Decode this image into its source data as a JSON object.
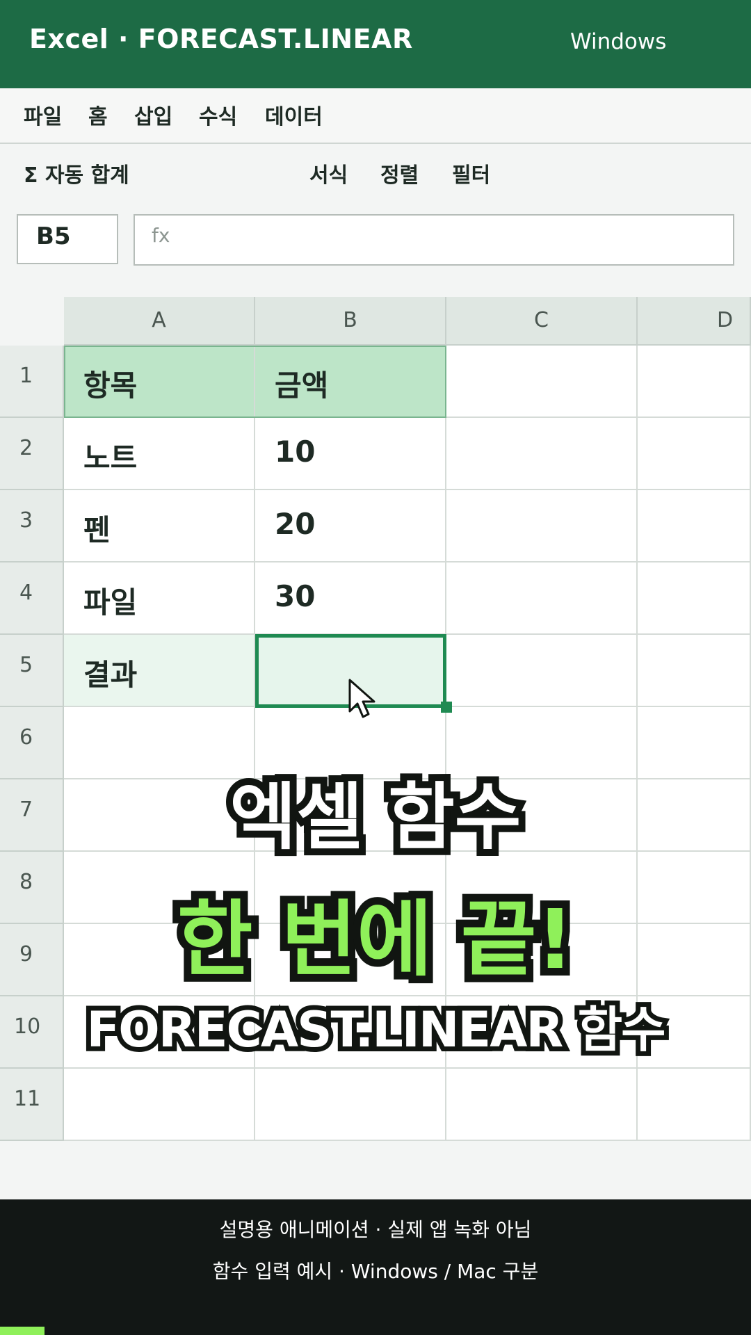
{
  "app": {
    "title": "Excel · FORECAST.LINEAR",
    "platform": "Windows"
  },
  "menu": [
    "파일",
    "홈",
    "삽입",
    "수식",
    "데이터"
  ],
  "ribbon": {
    "autosum": "Σ 자동 합계",
    "format": "서식",
    "sort": "정렬",
    "filter": "필터"
  },
  "namebox": "B5",
  "formula": {
    "fx_label": "fx",
    "value": ""
  },
  "grid": {
    "columns": [
      "A",
      "B",
      "C",
      "D"
    ],
    "rows": [
      "1",
      "2",
      "3",
      "4",
      "5",
      "6",
      "7",
      "8",
      "9",
      "10",
      "11"
    ],
    "cells": [
      [
        "항목",
        "금액",
        "",
        ""
      ],
      [
        "노트",
        "10",
        "",
        ""
      ],
      [
        "펜",
        "20",
        "",
        ""
      ],
      [
        "파일",
        "30",
        "",
        ""
      ],
      [
        "결과",
        "",
        "",
        ""
      ]
    ],
    "selected_cell": "B5"
  },
  "overlay": {
    "line1": "엑셀 함수",
    "line2": "한 번에 끝!",
    "line3": "FORECAST.LINEAR 함수"
  },
  "footer": {
    "line1": "설명용 애니메이션 · 실제 앱 녹화 아님",
    "line2": "함수 입력 예시 · Windows / Mac 구분"
  },
  "colors": {
    "brand": "#1d6b45",
    "accent": "#8ff05a",
    "selection": "#1f8a52",
    "header_fill": "#bde5c8"
  },
  "icons": {
    "cursor": "mouse-pointer-icon"
  }
}
